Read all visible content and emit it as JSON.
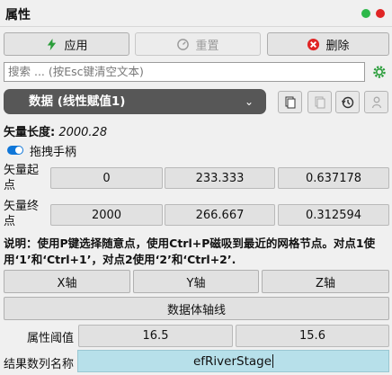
{
  "window": {
    "title": "属性"
  },
  "toolbar": {
    "apply_label": "应用",
    "reset_label": "重置",
    "delete_label": "删除"
  },
  "search": {
    "placeholder": "搜索 ... (按Esc键清空文本)"
  },
  "dropdown": {
    "selected": "数据 (线性赋值1)"
  },
  "vector_length": {
    "label": "矢量长度:",
    "value": "2000.28"
  },
  "drag_handle": {
    "label": "拖拽手柄",
    "enabled": true
  },
  "start_point": {
    "label": "矢量起点",
    "values": [
      "0",
      "233.333",
      "0.637178"
    ]
  },
  "end_point": {
    "label": "矢量终点",
    "values": [
      "2000",
      "266.667",
      "0.312594"
    ]
  },
  "instructions": "说明：使用P键选择随意点，使用Ctrl+P磁吸到最近的网格节点。对点1使用‘1’和‘Ctrl+1’，对点2使用‘2’和‘Ctrl+2’.",
  "axes": {
    "x_label": "X轴",
    "y_label": "Y轴",
    "z_label": "Z轴",
    "dataset_axis_label": "数据体轴线"
  },
  "threshold": {
    "label": "属性阈值",
    "values": [
      "16.5",
      "15.6"
    ]
  },
  "result_column": {
    "label": "结果数列名称",
    "value": "efRiverStage"
  },
  "colors": {
    "accent": "#0f76d8",
    "dropdown_bg": "#575757",
    "result_bg": "#b7e0ea",
    "delete_icon": "#e02525",
    "apply_icon": "#2a9d3a"
  }
}
